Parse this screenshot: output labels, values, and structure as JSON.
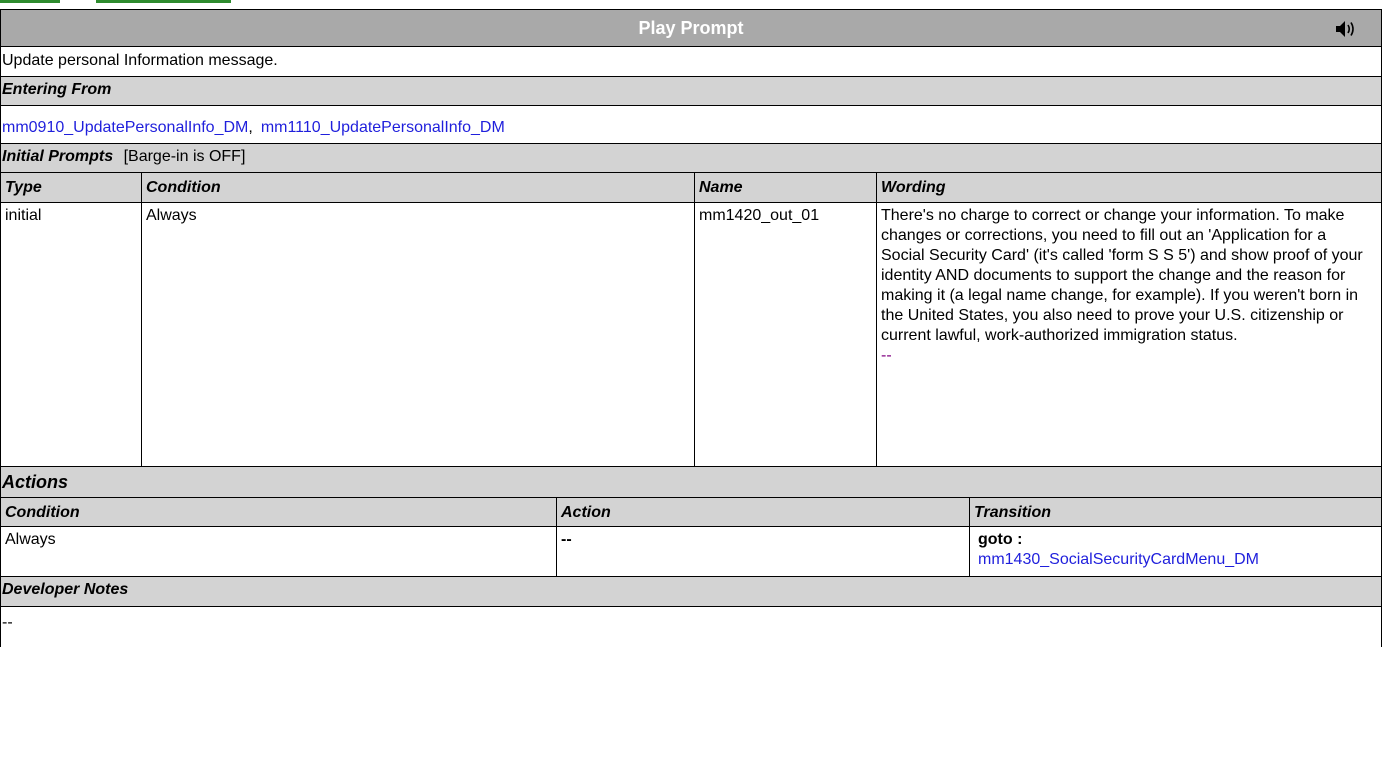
{
  "header": {
    "title": "Play Prompt",
    "icon": "speaker-icon"
  },
  "description": "Update personal Information message.",
  "entering_from": {
    "label": "Entering From",
    "links": [
      "mm0910_UpdatePersonalInfo_DM",
      "mm1110_UpdatePersonalInfo_DM"
    ],
    "separator": ","
  },
  "initial_prompts": {
    "label": "Initial Prompts",
    "barge_in": "[Barge-in is OFF]",
    "columns": [
      "Type",
      "Condition",
      "Name",
      "Wording"
    ],
    "rows": [
      {
        "type": "initial",
        "condition": "Always",
        "name": "mm1420_out_01",
        "wording": "There's no charge to correct or change your information. To make changes or corrections, you need to fill out an 'Application for a Social Security Card' (it's called 'form S S 5') and show proof of your identity AND documents to support the change and the reason for making it (a legal name change, for example).  If you weren't born in the United States, you also need to prove your U.S. citizenship or current lawful, work-authorized immigration status.",
        "wording_link": "--"
      }
    ]
  },
  "actions": {
    "label": "Actions",
    "columns": [
      "Condition",
      "Action",
      "Transition"
    ],
    "rows": [
      {
        "condition": "Always",
        "action": "--",
        "transition_prefix": "goto :",
        "transition_link": "mm1430_SocialSecurityCardMenu_DM"
      }
    ]
  },
  "developer_notes": {
    "label": "Developer Notes",
    "value": "--"
  },
  "colors": {
    "header_bg": "#a9a9a9",
    "section_bg": "#d3d3d3",
    "link": "#1f1fdc",
    "visited_link": "#800080",
    "top_band": "#2e8b2e"
  }
}
